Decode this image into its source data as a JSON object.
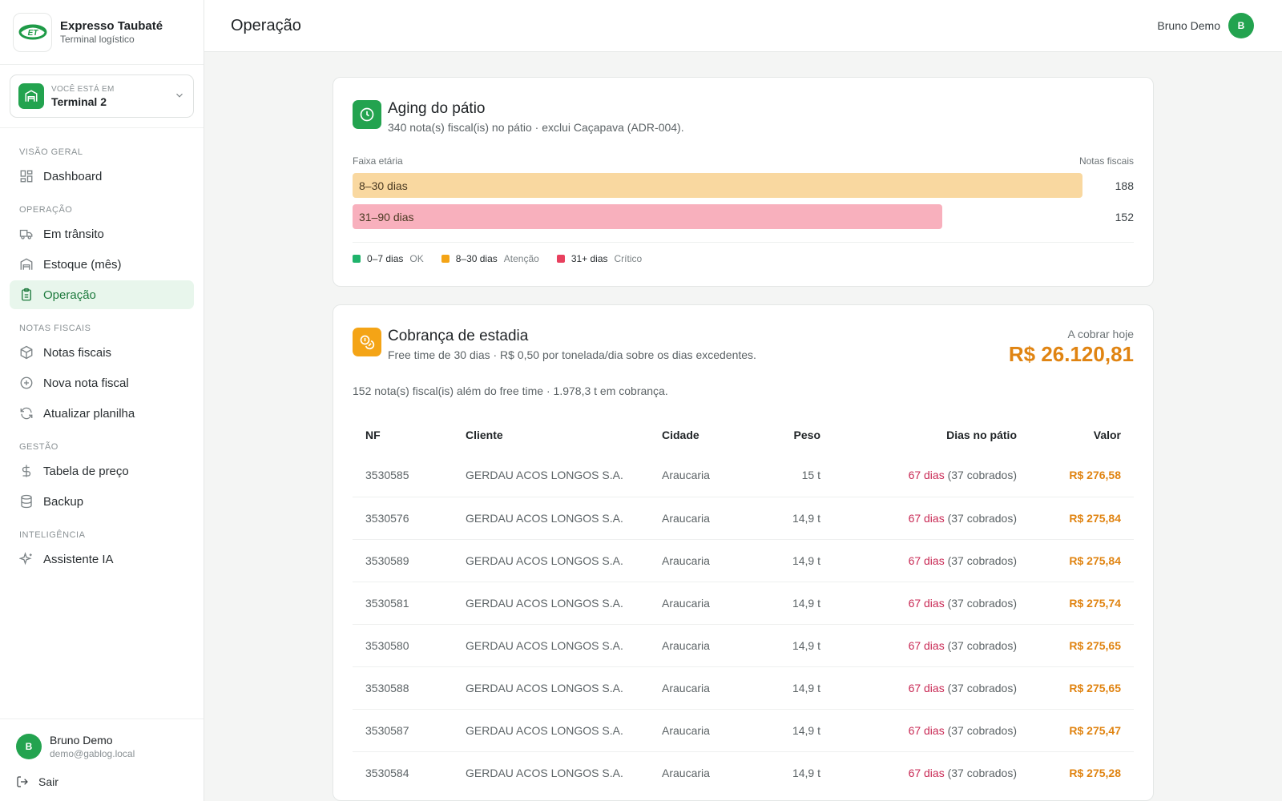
{
  "brand": {
    "name": "Expresso Taubaté",
    "subtitle": "Terminal logístico",
    "logo_text": "ET"
  },
  "terminal": {
    "caption": "VOCÊ ESTÁ EM",
    "name": "Terminal 2"
  },
  "nav": {
    "sections": [
      {
        "title": "VISÃO GERAL",
        "items": [
          {
            "label": "Dashboard",
            "icon": "dashboard-icon"
          }
        ]
      },
      {
        "title": "OPERAÇÃO",
        "items": [
          {
            "label": "Em trânsito",
            "icon": "truck-icon"
          },
          {
            "label": "Estoque (mês)",
            "icon": "warehouse-icon"
          },
          {
            "label": "Operação",
            "icon": "clipboard-icon",
            "active": true
          }
        ]
      },
      {
        "title": "NOTAS FISCAIS",
        "items": [
          {
            "label": "Notas fiscais",
            "icon": "package-icon"
          },
          {
            "label": "Nova nota fiscal",
            "icon": "plus-circle-icon"
          },
          {
            "label": "Atualizar planilha",
            "icon": "refresh-icon"
          }
        ]
      },
      {
        "title": "GESTÃO",
        "items": [
          {
            "label": "Tabela de preço",
            "icon": "dollar-icon"
          },
          {
            "label": "Backup",
            "icon": "database-icon"
          }
        ]
      },
      {
        "title": "INTELIGÊNCIA",
        "items": [
          {
            "label": "Assistente IA",
            "icon": "sparkles-icon"
          }
        ]
      }
    ]
  },
  "user": {
    "initial": "B",
    "name": "Bruno Demo",
    "email": "demo@gablog.local",
    "logout_label": "Sair"
  },
  "header": {
    "title": "Operação",
    "user_name": "Bruno Demo",
    "user_initial": "B"
  },
  "aging": {
    "title": "Aging do pátio",
    "subtitle": "340 nota(s) fiscal(is) no pátio · exclui Caçapava (ADR-004).",
    "x_label": "Faixa etária",
    "y_label": "Notas fiscais",
    "legend": [
      {
        "range": "0–7 dias",
        "status": "OK",
        "color": "#1fb36b"
      },
      {
        "range": "8–30 dias",
        "status": "Atenção",
        "color": "#f4a416"
      },
      {
        "range": "31+ dias",
        "status": "Crítico",
        "color": "#e8405e"
      }
    ]
  },
  "chart_data": {
    "type": "bar",
    "orientation": "horizontal",
    "categories": [
      "8–30 dias",
      "31–90 dias"
    ],
    "values": [
      188,
      152
    ],
    "colors": [
      "#f9d8a0",
      "#f8b0bd"
    ],
    "xlabel": "Faixa etária",
    "ylabel": "Notas fiscais"
  },
  "billing": {
    "title": "Cobrança de estadia",
    "subtitle": "Free time de 30 dias · R$ 0,50 por tonelada/dia sobre os dias excedentes.",
    "charge_label": "A cobrar hoje",
    "charge_value": "R$ 26.120,81",
    "summary": "152 nota(s) fiscal(is) além do free time · 1.978,3 t em cobrança.",
    "columns": [
      "NF",
      "Cliente",
      "Cidade",
      "Peso",
      "Dias no pátio",
      "Valor"
    ],
    "rows": [
      {
        "nf": "3530585",
        "client": "GERDAU ACOS LONGOS S.A.",
        "city": "Araucaria",
        "weight": "15 t",
        "days": "67 dias",
        "charged": "(37 cobrados)",
        "value": "R$ 276,58"
      },
      {
        "nf": "3530576",
        "client": "GERDAU ACOS LONGOS S.A.",
        "city": "Araucaria",
        "weight": "14,9 t",
        "days": "67 dias",
        "charged": "(37 cobrados)",
        "value": "R$ 275,84"
      },
      {
        "nf": "3530589",
        "client": "GERDAU ACOS LONGOS S.A.",
        "city": "Araucaria",
        "weight": "14,9 t",
        "days": "67 dias",
        "charged": "(37 cobrados)",
        "value": "R$ 275,84"
      },
      {
        "nf": "3530581",
        "client": "GERDAU ACOS LONGOS S.A.",
        "city": "Araucaria",
        "weight": "14,9 t",
        "days": "67 dias",
        "charged": "(37 cobrados)",
        "value": "R$ 275,74"
      },
      {
        "nf": "3530580",
        "client": "GERDAU ACOS LONGOS S.A.",
        "city": "Araucaria",
        "weight": "14,9 t",
        "days": "67 dias",
        "charged": "(37 cobrados)",
        "value": "R$ 275,65"
      },
      {
        "nf": "3530588",
        "client": "GERDAU ACOS LONGOS S.A.",
        "city": "Araucaria",
        "weight": "14,9 t",
        "days": "67 dias",
        "charged": "(37 cobrados)",
        "value": "R$ 275,65"
      },
      {
        "nf": "3530587",
        "client": "GERDAU ACOS LONGOS S.A.",
        "city": "Araucaria",
        "weight": "14,9 t",
        "days": "67 dias",
        "charged": "(37 cobrados)",
        "value": "R$ 275,47"
      },
      {
        "nf": "3530584",
        "client": "GERDAU ACOS LONGOS S.A.",
        "city": "Araucaria",
        "weight": "14,9 t",
        "days": "67 dias",
        "charged": "(37 cobrados)",
        "value": "R$ 275,28"
      }
    ]
  }
}
